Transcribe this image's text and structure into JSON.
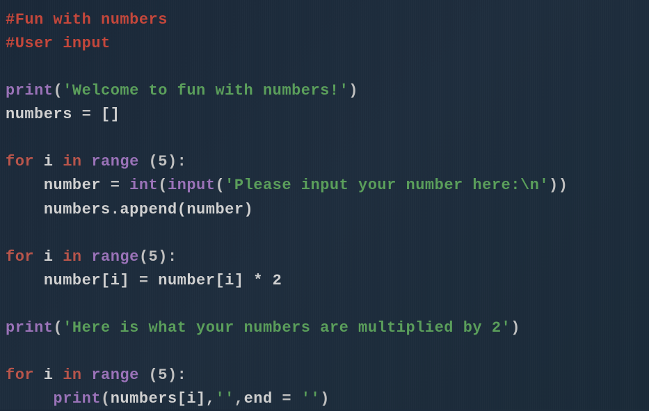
{
  "code": {
    "line1": "#Fun with numbers",
    "line2": "#User input",
    "line4_print": "print",
    "line4_str": "'Welcome to fun with numbers!'",
    "line5_var": "numbers ",
    "line5_op": "=",
    "line5_val": " []",
    "line7_for": "for",
    "line7_var": " i ",
    "line7_in": "in",
    "line7_range": "range",
    "line7_args": " (5):",
    "line8_indent": "    ",
    "line8_var": "number ",
    "line8_op": "=",
    "line8_int": " int",
    "line8_input": "input",
    "line8_str": "'Please input your number here:\\n'",
    "line9_indent": "    ",
    "line9_call": "numbers.append(number)",
    "line11_for": "for",
    "line11_var": " i ",
    "line11_in": "in",
    "line11_range": "range",
    "line11_args": "(5):",
    "line12_indent": "    ",
    "line12_lhs": "number[i] ",
    "line12_op": "=",
    "line12_rhs": " number[i] ",
    "line12_mul": "* 2",
    "line14_print": "print",
    "line14_str": "'Here is what your numbers are multiplied by 2'",
    "line16_for": "for",
    "line16_var": " i ",
    "line16_in": "in",
    "line16_range": "range",
    "line16_args": " (5):",
    "line17_indent": "     ",
    "line17_print": "print",
    "line17_arg1": "numbers[i],",
    "line17_str1": "''",
    "line17_comma": ",",
    "line17_end": "end ",
    "line17_eq": "=",
    "line17_str2": " ''"
  }
}
